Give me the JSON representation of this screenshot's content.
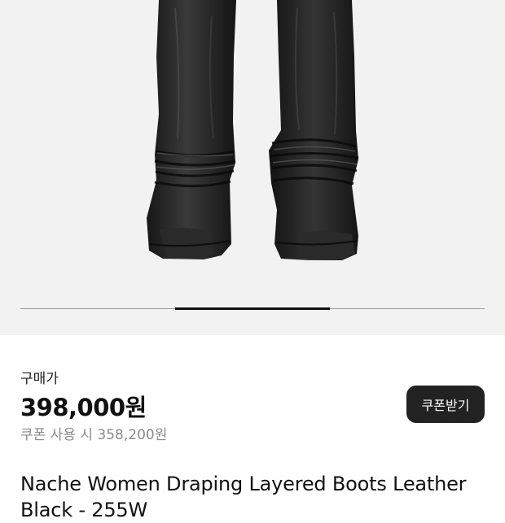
{
  "price": {
    "label": "구매가",
    "value": "398,000원",
    "coupon_price": "쿠폰 사용 시 358,200원"
  },
  "coupon_button": {
    "label": "쿠폰받기"
  },
  "product": {
    "title": "Nache Women Draping Layered Boots Leather Black - 255W"
  },
  "gallery": {
    "image": "black-leather-draped-boots-photo",
    "slide_indicator": {
      "active_index": 2,
      "total": 3
    }
  },
  "colors": {
    "gallery_background": "#f2f2f2",
    "button_background": "#222222",
    "muted_text": "#8a8a8a"
  }
}
